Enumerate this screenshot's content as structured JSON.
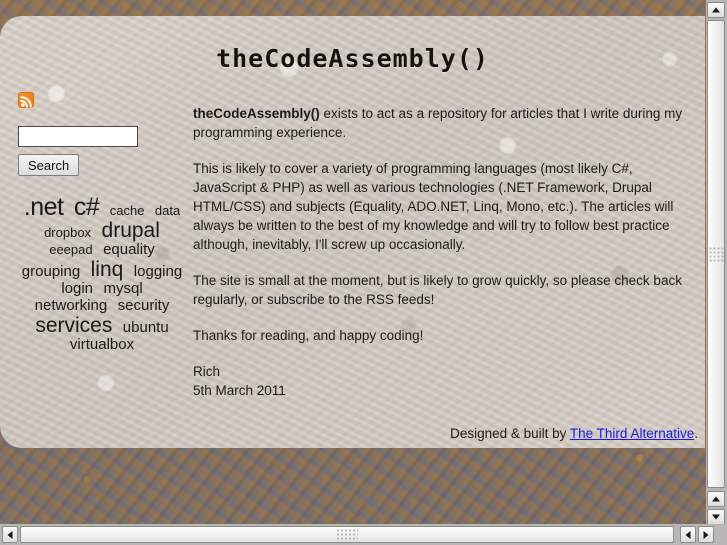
{
  "site": {
    "title": "theCodeAssembly()",
    "accent_link_color": "#1a1ae0",
    "rss_color": "#e87a15"
  },
  "sidebar": {
    "rss_label": "rss-feed",
    "search": {
      "value": "",
      "placeholder": "",
      "button_label": "Search"
    },
    "tag_cloud": [
      {
        "label": ".net",
        "size": "xl"
      },
      {
        "label": "c#",
        "size": "xl"
      },
      {
        "label": "cache",
        "size": "sm"
      },
      {
        "label": "data",
        "size": "sm"
      },
      {
        "label": "dropbox",
        "size": "sm"
      },
      {
        "label": "drupal",
        "size": "lg"
      },
      {
        "label": "eeepad",
        "size": "sm"
      },
      {
        "label": "equality",
        "size": "md"
      },
      {
        "label": "grouping",
        "size": "md"
      },
      {
        "label": "linq",
        "size": "lg"
      },
      {
        "label": "logging",
        "size": "md"
      },
      {
        "label": "login",
        "size": "md"
      },
      {
        "label": "mysql",
        "size": "md"
      },
      {
        "label": "networking",
        "size": "md"
      },
      {
        "label": "security",
        "size": "md"
      },
      {
        "label": "services",
        "size": "lg"
      },
      {
        "label": "ubuntu",
        "size": "md"
      },
      {
        "label": "virtualbox",
        "size": "md"
      }
    ]
  },
  "article": {
    "intro_bold": "theCodeAssembly()",
    "intro_rest": " exists to act as a repository for articles that I write during my programming experience.",
    "para2": "This is likely to cover a variety of programming languages (most likely C#, JavaScript & PHP) as well as various technologies (.NET Framework, Drupal HTML/CSS) and subjects (Equality, ADO.NET, Linq, Mono, etc.).  The articles will always be written to the best of my knowledge and will try to follow best practice although, inevitably, I'll screw up occasionally.",
    "para3": "The site is small at the moment, but is likely to grow quickly, so please check back regularly, or subscribe to the RSS feeds!",
    "para4": "Thanks for reading, and happy coding!",
    "signature_name": "Rich",
    "signature_date": "5th March 2011"
  },
  "footer": {
    "prefix": "Designed & built by ",
    "link_label": "The Third Alternative",
    "suffix": "."
  },
  "scrollbars": {
    "vertical_label": "vertical-scrollbar",
    "horizontal_label": "horizontal-scrollbar"
  }
}
